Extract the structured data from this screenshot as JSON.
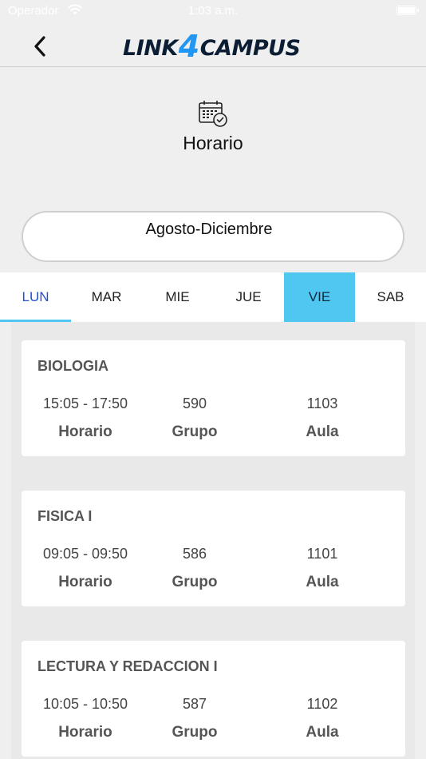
{
  "status_bar": {
    "carrier": "Operador",
    "time": "1:03 a.m."
  },
  "navbar": {
    "logo_left": "LINK",
    "logo_num": "4",
    "logo_right": "CAMPUS"
  },
  "header": {
    "title": "Horario"
  },
  "period": {
    "label": "Agosto-Diciembre"
  },
  "tabs": [
    {
      "label": "LUN"
    },
    {
      "label": "MAR"
    },
    {
      "label": "MIE"
    },
    {
      "label": "JUE"
    },
    {
      "label": "VIE"
    },
    {
      "label": "SAB"
    }
  ],
  "colors": {
    "accent": "#4fc7f0",
    "active_tab_text": "#1e4fd6",
    "logo_accent": "#2196f3"
  },
  "courses": [
    {
      "name": "BIOLOGIA",
      "horario": "15:05 - 17:50",
      "grupo": "590",
      "aula": "1103",
      "horario_label": "Horario",
      "grupo_label": "Grupo",
      "aula_label": "Aula"
    },
    {
      "name": "FISICA I",
      "horario": "09:05 - 09:50",
      "grupo": "586",
      "aula": "1101",
      "horario_label": "Horario",
      "grupo_label": "Grupo",
      "aula_label": "Aula"
    },
    {
      "name": "LECTURA Y REDACCION I",
      "horario": "10:05 - 10:50",
      "grupo": "587",
      "aula": "1102",
      "horario_label": "Horario",
      "grupo_label": "Grupo",
      "aula_label": "Aula"
    }
  ]
}
